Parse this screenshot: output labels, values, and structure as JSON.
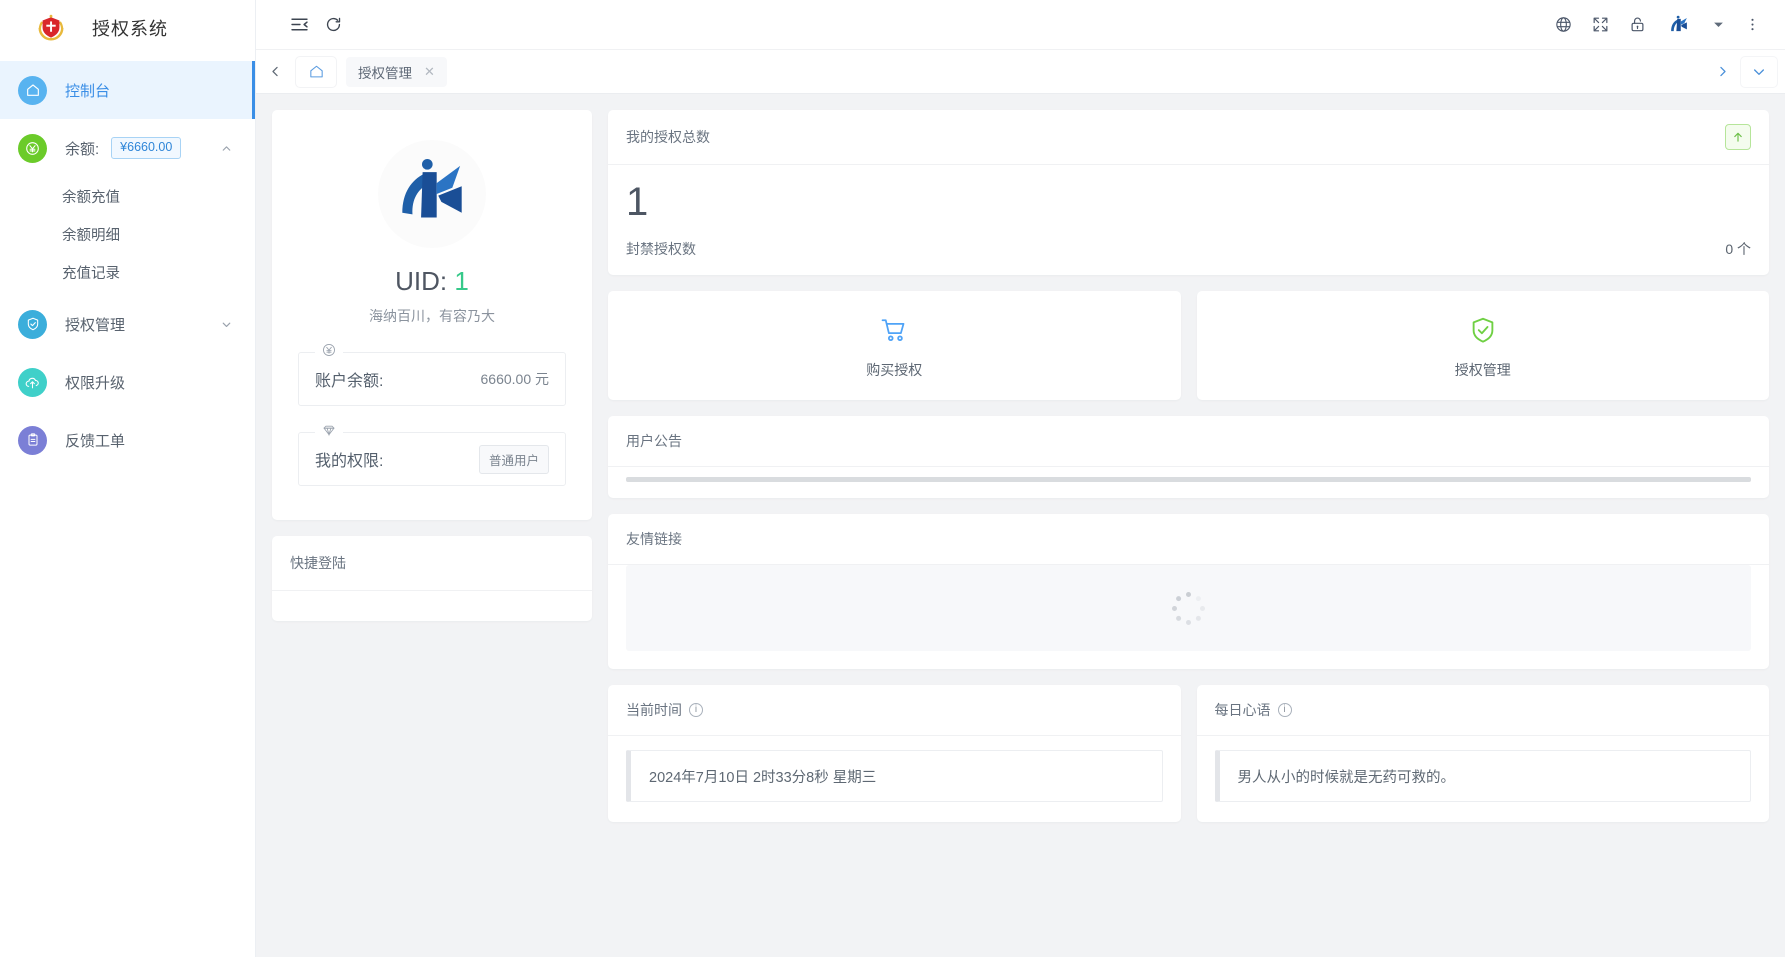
{
  "brand": {
    "title": "授权系统",
    "logo_icon": "red-shield-emblem-icon"
  },
  "sidebar": {
    "items": [
      {
        "label": "控制台",
        "icon": "home-icon",
        "icon_color": "#58b3f0",
        "active": true
      },
      {
        "label": "余额:",
        "icon": "yen-circle-icon",
        "icon_color": "#6bcb2a",
        "badge": "¥6660.00",
        "caret": "chevron-up-icon",
        "expanded": true
      },
      {
        "label": "授权管理",
        "icon": "shield-check-icon",
        "icon_color": "#3baedb",
        "caret": "chevron-down-icon"
      },
      {
        "label": "权限升级",
        "icon": "cloud-upload-icon",
        "icon_color": "#3fd0c9"
      },
      {
        "label": "反馈工单",
        "icon": "clipboard-icon",
        "icon_color": "#7b7fd6"
      }
    ],
    "balance_submenu": [
      "余额充值",
      "余额明细",
      "充值记录"
    ]
  },
  "topbar": {
    "collapse_icon": "menu-collapse-icon",
    "refresh_icon": "refresh-icon",
    "right_icons": [
      "globe-icon",
      "fullscreen-icon",
      "lock-icon",
      "avatar-logo-icon",
      "caret-down-icon",
      "more-vertical-icon"
    ]
  },
  "tabbar": {
    "prev_icon": "chevron-left-icon",
    "home_icon": "home-outline-icon",
    "tabs": [
      {
        "label": "授权管理",
        "close_icon": "close-icon",
        "active": true
      }
    ],
    "next_icon": "chevron-right-icon",
    "dropdown_icon": "chevron-down-icon"
  },
  "profile": {
    "avatar_icon": "brand-k-logo-icon",
    "uid_label": "UID:",
    "uid_value": "1",
    "motto": "海纳百川，有容乃大",
    "balance_legend_icon": "yen-circle-icon",
    "balance_label": "账户余额:",
    "balance_value": "6660.00 元",
    "role_legend_icon": "diamond-icon",
    "role_label": "我的权限:",
    "role_value": "普通用户"
  },
  "quick_login": {
    "title": "快捷登陆"
  },
  "stats": {
    "title": "我的授权总数",
    "trend_icon": "arrow-up-icon",
    "total": "1",
    "banned_label": "封禁授权数",
    "banned_value": "0 个"
  },
  "tiles": [
    {
      "label": "购买授权",
      "icon": "shopping-cart-icon",
      "color": "#4fa3f7"
    },
    {
      "label": "授权管理",
      "icon": "shield-check-icon",
      "color": "#6fd043"
    }
  ],
  "notice": {
    "title": "用户公告"
  },
  "links": {
    "title": "友情链接",
    "spinner_icon": "loading-spinner-icon"
  },
  "current_time": {
    "title": "当前时间",
    "info_icon": "info-icon",
    "value": "2024年7月10日 2时33分8秒 星期三"
  },
  "daily_quote": {
    "title": "每日心语",
    "info_icon": "info-icon",
    "value": "男人从小的时候就是无药可救的。"
  },
  "colors": {
    "accent": "#3a8ee6",
    "green": "#36c98a",
    "page_bg": "#f2f3f5"
  }
}
